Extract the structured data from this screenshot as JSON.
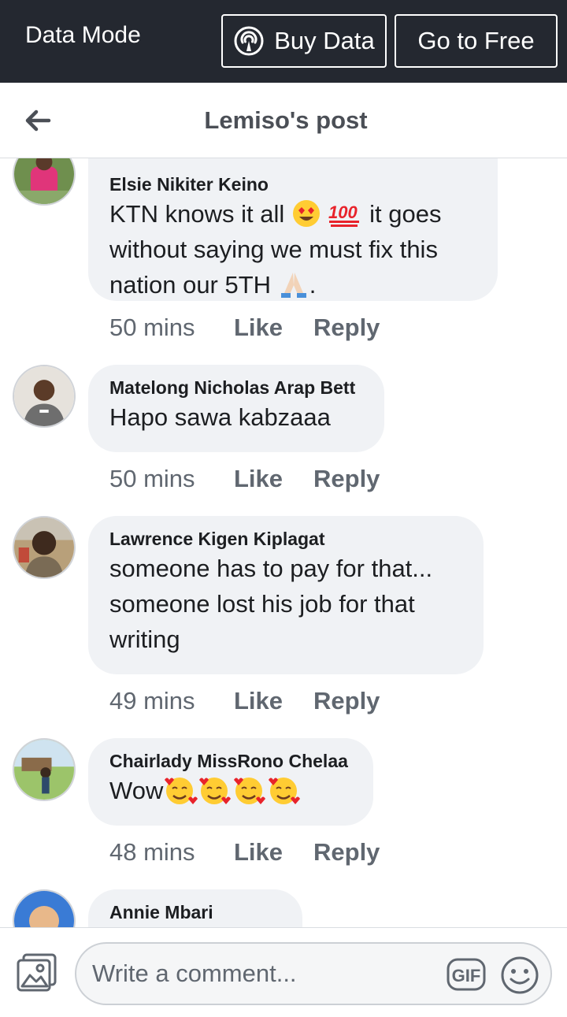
{
  "topbar": {
    "mode_label": "Data Mode",
    "buy_label": "Buy Data",
    "free_label": "Go to Free"
  },
  "header": {
    "title": "Lemiso's post"
  },
  "comments": [
    {
      "author": "Elsie Nikiter Keino",
      "text_part1": "KTN knows it all",
      "text_part2": "it goes without saying we must fix this nation our 5TH",
      "text_part3": ".",
      "emojis": [
        "heart-eyes-emoji",
        "hundred-points-emoji",
        "folded-hands-emoji"
      ],
      "time": "50 mins",
      "like": "Like",
      "reply": "Reply"
    },
    {
      "author": "Matelong Nicholas Arap Bett",
      "text": "Hapo sawa kabzaaa",
      "time": "50 mins",
      "like": "Like",
      "reply": "Reply"
    },
    {
      "author": "Lawrence Kigen Kiplagat",
      "text": "someone has to pay for that... someone lost his job for that writing",
      "time": "49 mins",
      "like": "Like",
      "reply": "Reply"
    },
    {
      "author": "Chairlady MissRono Chelaa",
      "text": "Wow",
      "emojis": [
        "smiling-face-with-hearts-emoji",
        "smiling-face-with-hearts-emoji",
        "smiling-face-with-hearts-emoji",
        "smiling-face-with-hearts-emoji"
      ],
      "time": "48 mins",
      "like": "Like",
      "reply": "Reply"
    },
    {
      "author": "Annie Mbari"
    }
  ],
  "composer": {
    "placeholder": "Write a comment...",
    "gif_label": "GIF"
  },
  "colors": {
    "topbar_bg": "#242830",
    "bubble_bg": "#f0f2f5",
    "meta_text": "#606770",
    "title_text": "#4b4f56"
  }
}
